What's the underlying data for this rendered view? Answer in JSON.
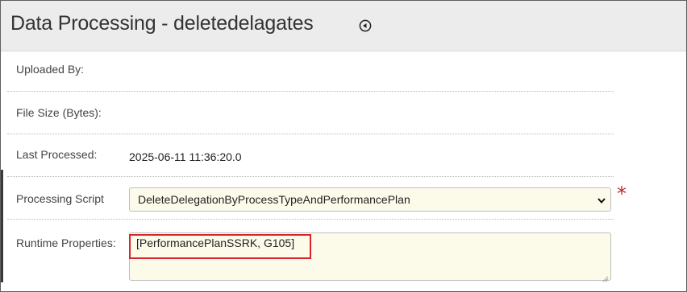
{
  "header": {
    "title": "Data Processing - deletedelagates",
    "icon": "circle-arrow-left-icon"
  },
  "fields": {
    "uploaded_by": {
      "label": "Uploaded By:",
      "value": ""
    },
    "file_size": {
      "label": "File Size (Bytes):",
      "value": ""
    },
    "last_processed": {
      "label": "Last Processed:",
      "value": "2025-06-11 11:36:20.0"
    },
    "processing_script": {
      "label": "Processing Script",
      "selected": "DeleteDelegationByProcessTypeAndPerformancePlan",
      "required_marker": "*"
    },
    "runtime_properties": {
      "label": "Runtime Properties:",
      "value": "[PerformancePlanSSRK, G105]"
    }
  },
  "colors": {
    "header_bg": "#ececec",
    "input_bg": "#fcfbea",
    "required": "#c0282d",
    "highlight_border": "#d8232a"
  }
}
